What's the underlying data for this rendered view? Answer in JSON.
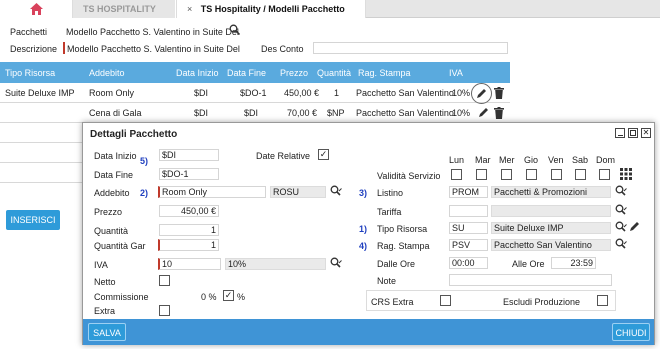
{
  "tabs": {
    "home_icon": "home-icon",
    "tab1": "TS HOSPITALITY",
    "tab2": "TS Hospitality / Modelli Pacchetto",
    "close": "×"
  },
  "header": {
    "pacchetti_label": "Pacchetti",
    "pacchetti_value": "Modello Pacchetto S. Valentino in Suite Del",
    "descrizione_label": "Descrizione",
    "descrizione_value": "Modello Pacchetto S. Valentino in Suite Del",
    "desconto_label": "Des Conto",
    "desconto_value": ""
  },
  "grid": {
    "columns": [
      "Tipo Risorsa",
      "Addebito",
      "Data Inizio",
      "Data Fine",
      "Prezzo",
      "Quantità",
      "Rag. Stampa",
      "IVA"
    ],
    "rows": [
      [
        "Suite Deluxe IMP",
        "Room Only",
        "$DI",
        "$DO-1",
        "450,00 €",
        "1",
        "Pacchetto San Valentino",
        "10%"
      ],
      [
        "",
        "Cena di Gala",
        "$DI",
        "$DI",
        "70,00 €",
        "$NP",
        "Pacchetto San Valentino",
        "10%"
      ]
    ],
    "insert_button": "INSERISCI"
  },
  "dialog": {
    "title": "Dettagli Pacchetto",
    "data_inizio_label": "Data Inizio",
    "data_inizio_value": "$DI",
    "data_fine_label": "Data Fine",
    "data_fine_value": "$DO-1",
    "addebito_label": "Addebito",
    "addebito_value": "Room Only",
    "addebito_code": "ROSU",
    "prezzo_label": "Prezzo",
    "prezzo_value": "450,00 €",
    "quantita_label": "Quantità",
    "quantita_value": "1",
    "quantita_gar_label": "Quantità Gar",
    "quantita_gar_value": "1",
    "iva_label": "IVA",
    "iva_value": "10",
    "iva_desc": "10%",
    "netto_label": "Netto",
    "commissione_label": "Commissione",
    "commissione_value": "0 %",
    "commissione_unit": "%",
    "extra_label": "Extra",
    "date_relative_label": "Date Relative",
    "validita_label": "Validità Servizio",
    "days": [
      "Lun",
      "Mar",
      "Mer",
      "Gio",
      "Ven",
      "Sab",
      "Dom"
    ],
    "listino_label": "Listino",
    "listino_code": "PROM",
    "listino_desc": "Pacchetti & Promozioni",
    "tariffa_label": "Tariffa",
    "tipo_risorsa_label": "Tipo Risorsa",
    "tipo_risorsa_code": "SU",
    "tipo_risorsa_desc": "Suite Deluxe IMP",
    "rag_stampa_label": "Rag. Stampa",
    "rag_stampa_code": "PSV",
    "rag_stampa_desc": "Pacchetto San Valentino",
    "dalle_ore_label": "Dalle Ore",
    "dalle_ore_value": "00:00",
    "alle_ore_label": "Alle Ore",
    "alle_ore_value": "23:59",
    "note_label": "Note",
    "crs_extra_label": "CRS Extra",
    "escludi_label": "Escludi Produzione",
    "save_button": "SALVA",
    "close_button": "CHIUDI",
    "markers": {
      "m5": "5)",
      "m2": "2)",
      "m3": "3)",
      "m1": "1)",
      "m4": "4)"
    }
  },
  "colors": {
    "accent": "#2e9bd9",
    "header": "#5aaade",
    "home": "#d9425c",
    "marker": "#1f3fbf"
  }
}
